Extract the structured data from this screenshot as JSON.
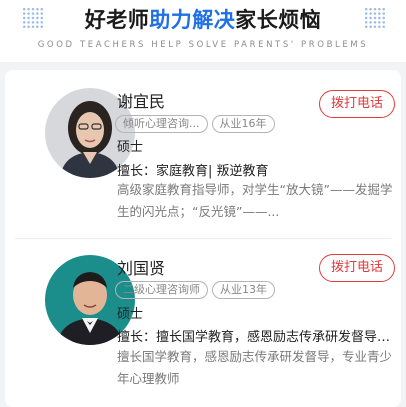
{
  "header": {
    "title_part1": "好老师",
    "title_highlight": "助力解决",
    "title_part2": "家长烦恼",
    "subtitle": "GOOD TEACHERS HELP SOLVE PARENTS' PROBLEMS"
  },
  "teachers": [
    {
      "name": "谢宜民",
      "tag1": "倾听心理咨询...",
      "tag2": "从业16年",
      "degree": "硕士",
      "skill": "擅长：家庭教育| 叛逆教育",
      "desc": "高级家庭教育指导师，对学生“放大镜”——发掘学生的闪光点；“反光镜”——...",
      "call_label": "拨打电话"
    },
    {
      "name": "刘国贤",
      "tag1": "二级心理咨询师",
      "tag2": "从业13年",
      "degree": "硕士",
      "skill": "擅长：擅长国学教育，感恩励志传承研发督导，专业青少年心理教师",
      "desc": "擅长国学教育，感恩励志传承研发督导，专业青少年心理教师",
      "call_label": "拨打电话"
    }
  ],
  "colors": {
    "accent_blue": "#1f6fe5",
    "call_red": "#e23b3b"
  }
}
